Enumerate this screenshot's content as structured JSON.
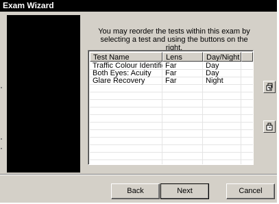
{
  "window": {
    "title": "Exam Wizard"
  },
  "instruction": {
    "line1": "You may reorder the tests within this exam by",
    "line2": "selecting a test and using the buttons on the right."
  },
  "table": {
    "headers": [
      "Test Name",
      "Lens",
      "Day/Night"
    ],
    "rows": [
      [
        "Traffic Colour Identific...",
        "Far",
        "Day"
      ],
      [
        "Both Eyes: Acuity",
        "Far",
        "Day"
      ],
      [
        "Glare Recovery",
        "Far",
        "Night"
      ]
    ]
  },
  "side_buttons": {
    "move_up_icon": "reorder-up-icon",
    "move_down_icon": "reorder-down-icon"
  },
  "buttons": {
    "back": "Back",
    "next": "Next",
    "cancel": "Cancel"
  }
}
